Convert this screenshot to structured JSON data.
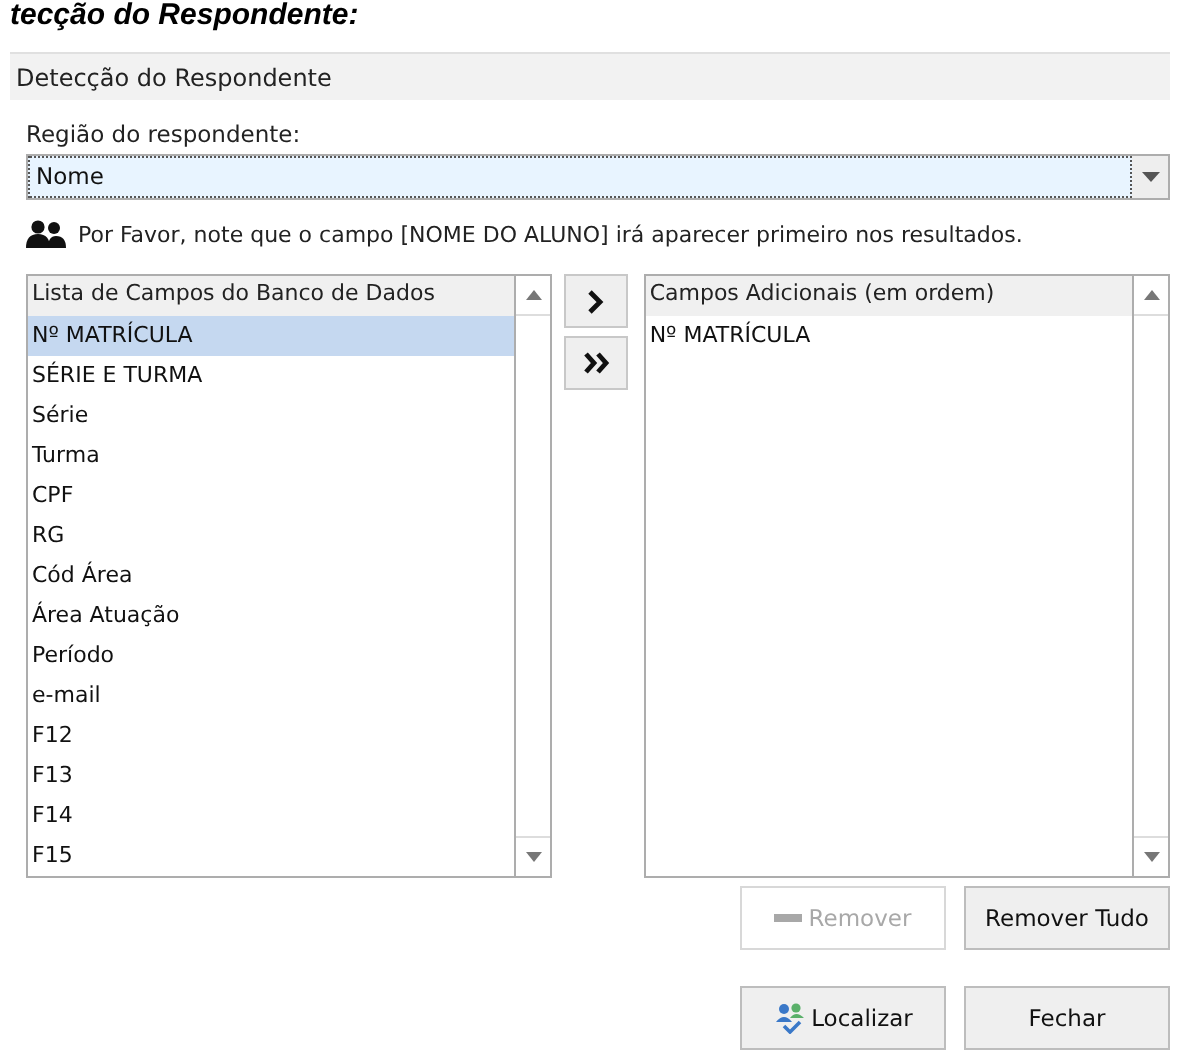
{
  "page_heading": "tecção do Respondente:",
  "window": {
    "title": "Detecção do Respondente"
  },
  "region": {
    "label": "Região do respondente:",
    "value": "Nome"
  },
  "note": "Por Favor, note que o campo [NOME DO ALUNO] irá aparecer primeiro nos resultados.",
  "fields_list": {
    "header": "Lista de Campos do Banco de Dados",
    "items": [
      {
        "label": "Nº MATRÍCULA",
        "selected": true
      },
      {
        "label": "SÉRIE E TURMA",
        "selected": false
      },
      {
        "label": "Série",
        "selected": false
      },
      {
        "label": "Turma",
        "selected": false
      },
      {
        "label": "CPF",
        "selected": false
      },
      {
        "label": "RG",
        "selected": false
      },
      {
        "label": "Cód Área",
        "selected": false
      },
      {
        "label": "Área Atuação",
        "selected": false
      },
      {
        "label": "Período",
        "selected": false
      },
      {
        "label": "e-mail",
        "selected": false
      },
      {
        "label": "F12",
        "selected": false
      },
      {
        "label": "F13",
        "selected": false
      },
      {
        "label": "F14",
        "selected": false
      },
      {
        "label": "F15",
        "selected": false
      }
    ]
  },
  "move_buttons": [
    {
      "kind": "single"
    },
    {
      "kind": "all"
    }
  ],
  "additional_list": {
    "header": "Campos Adicionais (em ordem)",
    "items": [
      {
        "label": "Nº MATRÍCULA",
        "selected": false
      }
    ]
  },
  "list_buttons": [
    {
      "label": "Remover",
      "disabled": true,
      "kind": "remove"
    },
    {
      "label": "Remover Tudo",
      "disabled": false,
      "kind": "plain"
    }
  ],
  "footer_buttons": [
    {
      "label": "Localizar",
      "disabled": false,
      "kind": "find"
    },
    {
      "label": "Fechar",
      "disabled": false,
      "kind": "plain"
    }
  ]
}
